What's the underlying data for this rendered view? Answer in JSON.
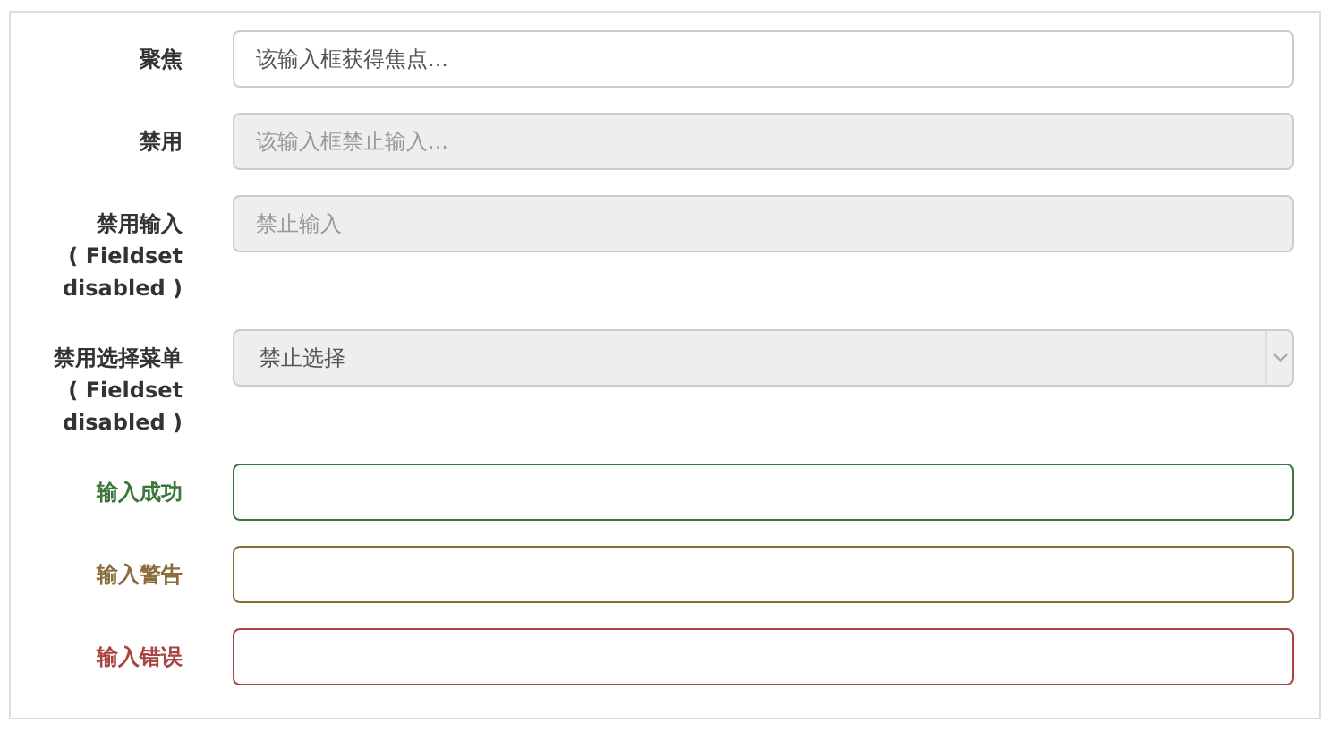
{
  "form": {
    "rows": [
      {
        "label": "聚焦",
        "kind": "text",
        "placeholder": "该输入框获得焦点...",
        "disabled": false
      },
      {
        "label": "禁用",
        "kind": "text",
        "placeholder": "该输入框禁止输入...",
        "disabled": true
      },
      {
        "label": "禁用输入 ( Fieldset disabled )",
        "kind": "text",
        "placeholder": "禁止输入",
        "disabled": true
      },
      {
        "label": "禁用选择菜单 ( Fieldset disabled )",
        "kind": "select",
        "value": "禁止选择",
        "disabled": true
      },
      {
        "label": "输入成功",
        "kind": "text",
        "disabled": false,
        "color": "#3c763d"
      },
      {
        "label": "输入警告",
        "kind": "text",
        "disabled": false,
        "color": "#8a6d3b"
      },
      {
        "label": "输入错误",
        "kind": "text",
        "disabled": false,
        "color": "#a94442"
      }
    ]
  }
}
